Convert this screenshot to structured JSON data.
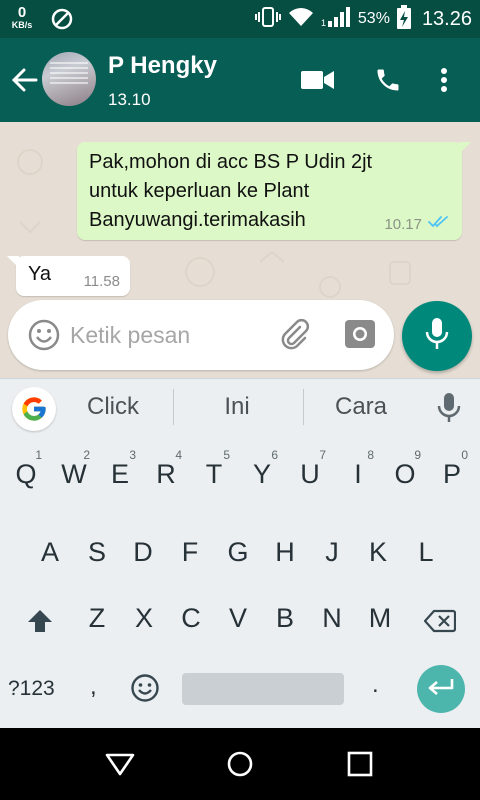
{
  "status_bar": {
    "net_speed": "0",
    "net_unit": "KB/s",
    "battery_percent": "53%",
    "time": "13.26"
  },
  "header": {
    "contact_name": "P Hengky",
    "contact_status": "13.10",
    "icons": [
      "back-arrow-icon",
      "video-call-icon",
      "phone-icon",
      "more-options-icon"
    ]
  },
  "chat": {
    "messages": [
      {
        "direction": "outgoing",
        "text": "Pak,mohon di acc BS P Udin 2jt\nuntuk keperluan ke Plant\nBanyuwangi.terimakasih",
        "time": "10.17",
        "status": "read"
      },
      {
        "direction": "incoming",
        "text": "Ya",
        "time": "11.58"
      }
    ]
  },
  "composer": {
    "placeholder": "Ketik pesan",
    "value": ""
  },
  "keyboard": {
    "suggestions": [
      "Click",
      "Ini",
      "Cara"
    ],
    "row1": [
      {
        "key": "Q",
        "hint": "1"
      },
      {
        "key": "W",
        "hint": "2"
      },
      {
        "key": "E",
        "hint": "3"
      },
      {
        "key": "R",
        "hint": "4"
      },
      {
        "key": "T",
        "hint": "5"
      },
      {
        "key": "Y",
        "hint": "6"
      },
      {
        "key": "U",
        "hint": "7"
      },
      {
        "key": "I",
        "hint": "8"
      },
      {
        "key": "O",
        "hint": "9"
      },
      {
        "key": "P",
        "hint": "0"
      }
    ],
    "row2": [
      "A",
      "S",
      "D",
      "F",
      "G",
      "H",
      "J",
      "K",
      "L"
    ],
    "row3": [
      "Z",
      "X",
      "C",
      "V",
      "B",
      "N",
      "M"
    ],
    "bottom_row": {
      "symbols": "?123",
      "comma": ",",
      "period": "."
    }
  },
  "colors": {
    "status_bar": "#064d42",
    "app_bar": "#075e54",
    "chat_background": "#e6ded4",
    "outgoing_bubble": "#dcf8c6",
    "accent": "#00897b",
    "read_ticks": "#4fc3f7"
  }
}
